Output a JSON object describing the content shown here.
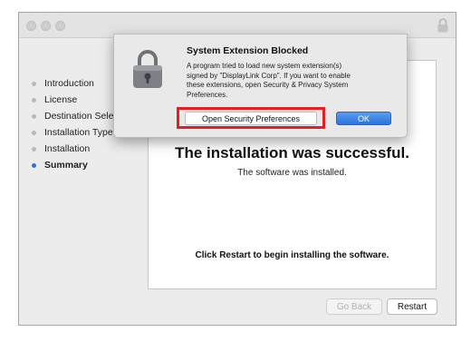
{
  "window": {
    "steps": [
      {
        "label": "Introduction",
        "active": false
      },
      {
        "label": "License",
        "active": false
      },
      {
        "label": "Destination Sele",
        "active": false
      },
      {
        "label": "Installation Type",
        "active": false
      },
      {
        "label": "Installation",
        "active": false
      },
      {
        "label": "Summary",
        "active": true
      }
    ],
    "content": {
      "title": "The installation was successful.",
      "subtitle": "The software was installed.",
      "restart_message": "Click Restart to begin installing the software."
    },
    "buttons": {
      "go_back": "Go Back",
      "restart": "Restart"
    }
  },
  "dialog": {
    "title": "System Extension Blocked",
    "body_lines": [
      "A program tried to load new system extension(s)",
      "signed by \"DisplayLink Corp\". If you want to enable",
      "these extensions, open Security & Privacy System",
      "Preferences."
    ],
    "open_prefs_label": "Open Security Preferences",
    "ok_label": "OK",
    "icon": "lock-icon"
  },
  "colors": {
    "accent": "#2f6fe0",
    "highlight": "#e21f27",
    "ok_button": "#2c74dd"
  }
}
